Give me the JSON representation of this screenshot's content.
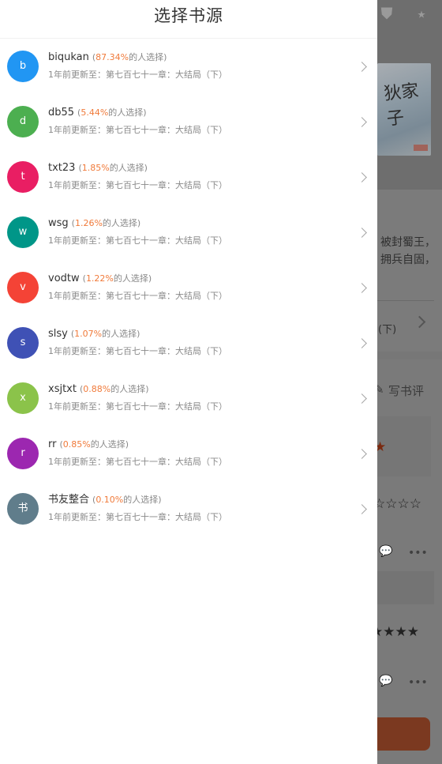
{
  "drawer": {
    "title": "选择书源",
    "sources": [
      {
        "letter": "b",
        "name": "biqukan",
        "pct": "87.34%",
        "color": "#2196f3"
      },
      {
        "letter": "d",
        "name": "db55",
        "pct": "5.44%",
        "color": "#4caf50"
      },
      {
        "letter": "t",
        "name": "txt23",
        "pct": "1.85%",
        "color": "#e91e63"
      },
      {
        "letter": "w",
        "name": "wsg",
        "pct": "1.26%",
        "color": "#009688"
      },
      {
        "letter": "v",
        "name": "vodtw",
        "pct": "1.22%",
        "color": "#f44336"
      },
      {
        "letter": "s",
        "name": "slsy",
        "pct": "1.07%",
        "color": "#3f51b5"
      },
      {
        "letter": "x",
        "name": "xsjtxt",
        "pct": "0.88%",
        "color": "#8bc34a"
      },
      {
        "letter": "r",
        "name": "rr",
        "pct": "0.85%",
        "color": "#9c27b0"
      },
      {
        "letter": "书",
        "name": "书友整合",
        "pct": "0.10%",
        "color": "#607d8b"
      }
    ],
    "share_open": "(",
    "share_suffix": "的人选择)",
    "update_text": "1年前更新至：第七百七十一章：大结局（下）"
  },
  "background": {
    "cover_title": "狄家子",
    "summary_line1": "被封蜀王，",
    "summary_line2": "拥兵自固，",
    "latest_chapter_tail": "(下)",
    "write_review": "写书评",
    "more": "•••"
  }
}
